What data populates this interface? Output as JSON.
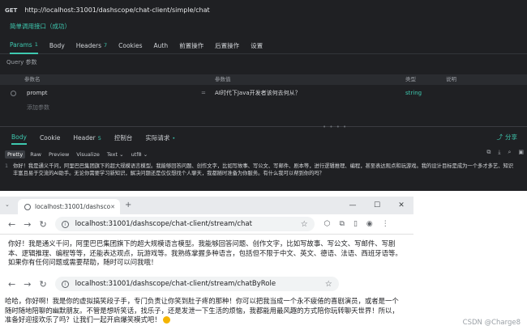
{
  "api": {
    "method": "GET",
    "url": "http://localhost:31001/dashscope/chat-client/simple/chat",
    "name": "简单调用接口（成功）",
    "tabs": [
      {
        "label": "Params",
        "count": "1"
      },
      {
        "label": "Body",
        "count": ""
      },
      {
        "label": "Headers",
        "count": "7"
      },
      {
        "label": "Cookies",
        "count": ""
      },
      {
        "label": "Auth",
        "count": ""
      },
      {
        "label": "前置操作",
        "count": ""
      },
      {
        "label": "后置操作",
        "count": ""
      },
      {
        "label": "设置",
        "count": ""
      }
    ],
    "query_section": "Query 参数",
    "columns": {
      "name": "参数名",
      "value": "参数值",
      "type": "类型",
      "desc": "说明"
    },
    "param": {
      "name": "prompt",
      "eq": "=",
      "value": "AI时代下Java开发者该何去何从？",
      "type": "string"
    },
    "add_param": "添加参数",
    "resp_tabs": [
      {
        "label": "Body",
        "count": ""
      },
      {
        "label": "Cookie",
        "count": ""
      },
      {
        "label": "Header",
        "count": "5"
      },
      {
        "label": "控制台",
        "count": ""
      },
      {
        "label": "实际请求",
        "count": "•"
      }
    ],
    "share": "分享",
    "resp_tools": [
      "Pretty",
      "Raw",
      "Preview",
      "Visualize",
      "Text ⌄",
      "utf8 ⌄"
    ],
    "resp_line": "1",
    "resp_text": "你好！我是通义千问，阿里巴巴集团旗下的超大规模语言模型。我能够回答问题、创作文字，比如写故事、写公文、写邮件、剧本等，进行逻辑推理、编程，甚至表达观点和玩游戏。我的设计目标是成为一个多才多艺、知识丰富且易于交流的AI助手。无论你需要学习新知识，解决问题还是仅仅想找个人聊天，我都随时准备为你服务。有什么我可以帮到你的吗？"
  },
  "browser1": {
    "tab_label": "localhost:31001/dashscope/c",
    "url": "localhost:31001/dashscope/chat-client/stream/chat",
    "content": "你好！我是通义千问，阿里巴巴集团旗下的超大规模语言模型。我能够回答问题、创作文字，比如写故事、写公文、写邮件、写剧本、逻辑推理、编程等等，还能表达观点，玩游戏等。我熟练掌握多种语言，包括但不限于中文、英文、德语、法语、西班牙语等。如果你有任何问题或需要帮助，随时可以问我哦！"
  },
  "browser2": {
    "url": "localhost:31001/dashscope/chat-client/stream/chatByRole",
    "content": "哈哈，你好啊！我是你的虚拟搞笑段子手，专门负责让你笑到肚子疼的那种！你可以把我当成一个永不疲倦的喜剧演员，或者是一个随时随地陪聊的幽默朋友。不管是想听笑话，找乐子，还是发泄一下生活的烦恼，我都能用最风趣的方式陪你玩转聊天世界！所以，准备好迎接欢乐了吗？让我们一起开启爆笑模式吧！"
  },
  "watermark": "CSDN @Charge8"
}
